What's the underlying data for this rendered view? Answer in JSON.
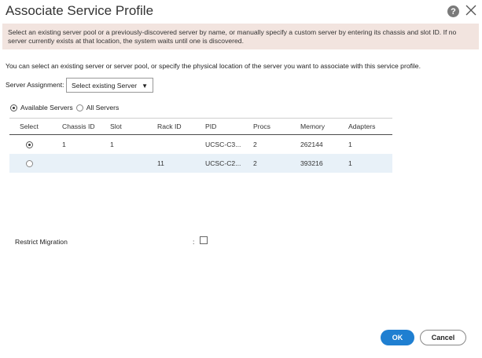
{
  "dialog": {
    "title": "Associate Service Profile",
    "help_icon_text": "?"
  },
  "banner": {
    "text": "Select an existing server pool or a previously-discovered server by name, or manually specify a custom server by entering its chassis and slot ID. If no server currently exists at that location, the system waits until one is discovered."
  },
  "description": "You can select an existing server or server pool, or specify the physical location of the server you want to associate with this service profile.",
  "assignment": {
    "label": "Server Assignment:",
    "selected": "Select existing Server",
    "caret": "▼"
  },
  "filter": {
    "available_label": "Available Servers",
    "all_label": "All Servers",
    "selected": "available"
  },
  "table": {
    "columns": [
      "Select",
      "Chassis ID",
      "Slot",
      "Rack ID",
      "PID",
      "Procs",
      "Memory",
      "Adapters"
    ],
    "rows": [
      {
        "selected": true,
        "chassis_id": "1",
        "slot": "1",
        "rack_id": "",
        "pid": "UCSC-C3...",
        "procs": "2",
        "memory": "262144",
        "adapters": "1"
      },
      {
        "selected": false,
        "chassis_id": "",
        "slot": "",
        "rack_id": "11",
        "pid": "UCSC-C2...",
        "procs": "2",
        "memory": "393216",
        "adapters": "1"
      }
    ]
  },
  "restrict": {
    "label": "Restrict Migration",
    "colon": ":",
    "checked": false
  },
  "buttons": {
    "ok": "OK",
    "cancel": "Cancel"
  },
  "colors": {
    "banner_bg": "#f2e4df",
    "ok_bg": "#1f7fd1",
    "alt_row_bg": "#e8f1f8"
  }
}
